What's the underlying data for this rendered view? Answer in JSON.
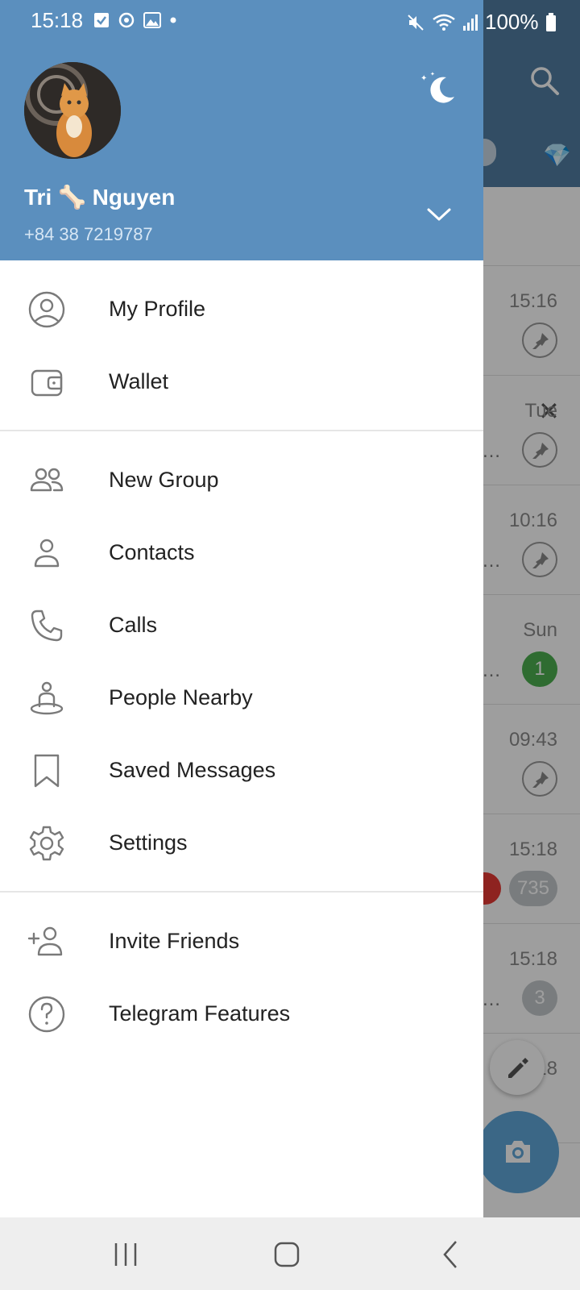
{
  "status_bar": {
    "time": "15:18",
    "battery": "100%"
  },
  "drawer": {
    "user_name": "Tri 🦴 Nguyen",
    "phone": "+84 38 7219787",
    "menu_group_1": [
      {
        "label": "My Profile",
        "icon": "profile-circle-icon"
      },
      {
        "label": "Wallet",
        "icon": "wallet-icon"
      }
    ],
    "menu_group_2": [
      {
        "label": "New Group",
        "icon": "group-icon"
      },
      {
        "label": "Contacts",
        "icon": "person-icon"
      },
      {
        "label": "Calls",
        "icon": "phone-icon"
      },
      {
        "label": "People Nearby",
        "icon": "people-nearby-icon"
      },
      {
        "label": "Saved Messages",
        "icon": "bookmark-icon"
      },
      {
        "label": "Settings",
        "icon": "gear-icon"
      }
    ],
    "menu_group_3": [
      {
        "label": "Invite Friends",
        "icon": "add-person-icon"
      },
      {
        "label": "Telegram Features",
        "icon": "question-icon"
      }
    ]
  },
  "background_chats": [
    {
      "time": "15:16",
      "indicator": "pin"
    },
    {
      "time": "Tue",
      "indicator": "pin"
    },
    {
      "time": "10:16",
      "indicator": "pin"
    },
    {
      "time": "Sun",
      "indicator": "badge",
      "badge": "1"
    },
    {
      "time": "09:43",
      "indicator": "pin"
    },
    {
      "time": "15:18",
      "indicator": "badge",
      "badge": "735"
    },
    {
      "time": "15:18",
      "indicator": "badge",
      "badge": "3"
    },
    {
      "time": "15:18",
      "indicator": "none"
    }
  ],
  "colors": {
    "header": "#5B8FBE",
    "bg_header": "#517DA2",
    "accent": "#5FA6D9",
    "badge_green": "#4CAF50"
  }
}
